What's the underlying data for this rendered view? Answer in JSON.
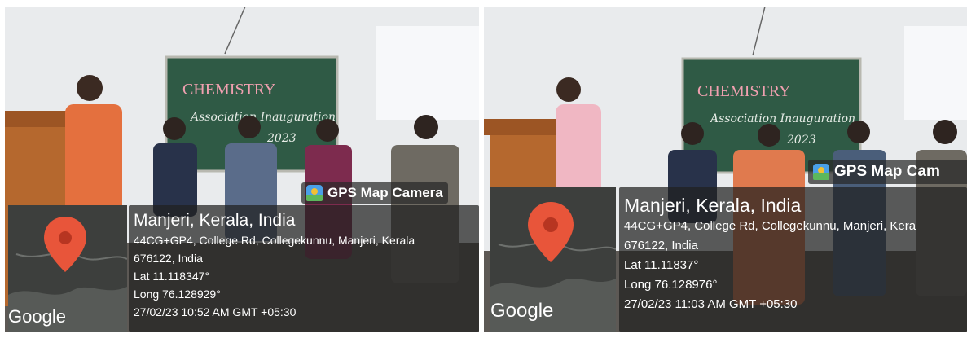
{
  "photos": [
    {
      "board_title": "CHEMISTRY",
      "board_line1": "Association Inauguration",
      "board_line2": "2023",
      "badge": "GPS Map Camera",
      "place": "Manjeri, Kerala, India",
      "address_line1": "44CG+GP4, College Rd, Collegekunnu, Manjeri, Kerala",
      "address_line2": "676122, India",
      "lat": "Lat 11.118347°",
      "long": "Long 76.128929°",
      "datetime": "27/02/23 10:52 AM GMT +05:30",
      "map_logo": "Google"
    },
    {
      "board_title": "CHEMISTRY",
      "board_line1": "Association Inauguration",
      "board_line2": "2023",
      "badge": "GPS Map Cam",
      "place": "Manjeri, Kerala, India",
      "address_line1": "44CG+GP4, College Rd, Collegekunnu, Manjeri, Kera",
      "address_line2": "676122, India",
      "lat": "Lat 11.11837°",
      "long": "Long 76.128976°",
      "datetime": "27/02/23 11:03 AM GMT +05:30",
      "map_logo": "Google"
    }
  ],
  "colors": {
    "wall": "#eceef0",
    "board": "#2f5a45",
    "chalk_pink": "#f0a0b0",
    "podium": "#b5682e",
    "pin": "#e8553a",
    "overlay": "#202020"
  }
}
